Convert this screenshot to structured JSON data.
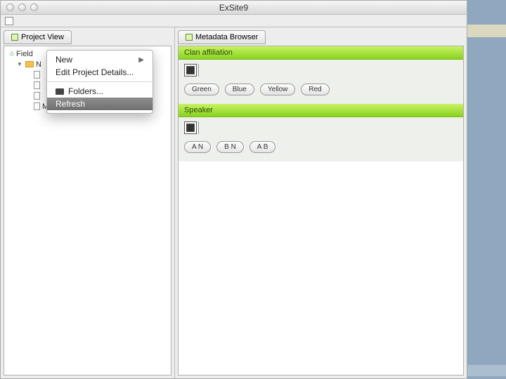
{
  "window": {
    "title": "ExSite9"
  },
  "leftPane": {
    "tabLabel": "Project View",
    "tree": {
      "root": "Field",
      "folder": "N",
      "files": [
        "",
        "",
        "",
        "MG_0015.JPG"
      ]
    }
  },
  "contextMenu": {
    "items": {
      "new": "New",
      "editDetails": "Edit Project Details...",
      "folders": "Folders...",
      "refresh": "Refresh"
    }
  },
  "rightPane": {
    "tabLabel": "Metadata Browser",
    "sections": [
      {
        "title": "Clan affiliation",
        "tags": [
          "Green",
          "Blue",
          "Yellow",
          "Red"
        ]
      },
      {
        "title": "Speaker",
        "tags": [
          "A N",
          "B N",
          "A B"
        ]
      }
    ]
  }
}
